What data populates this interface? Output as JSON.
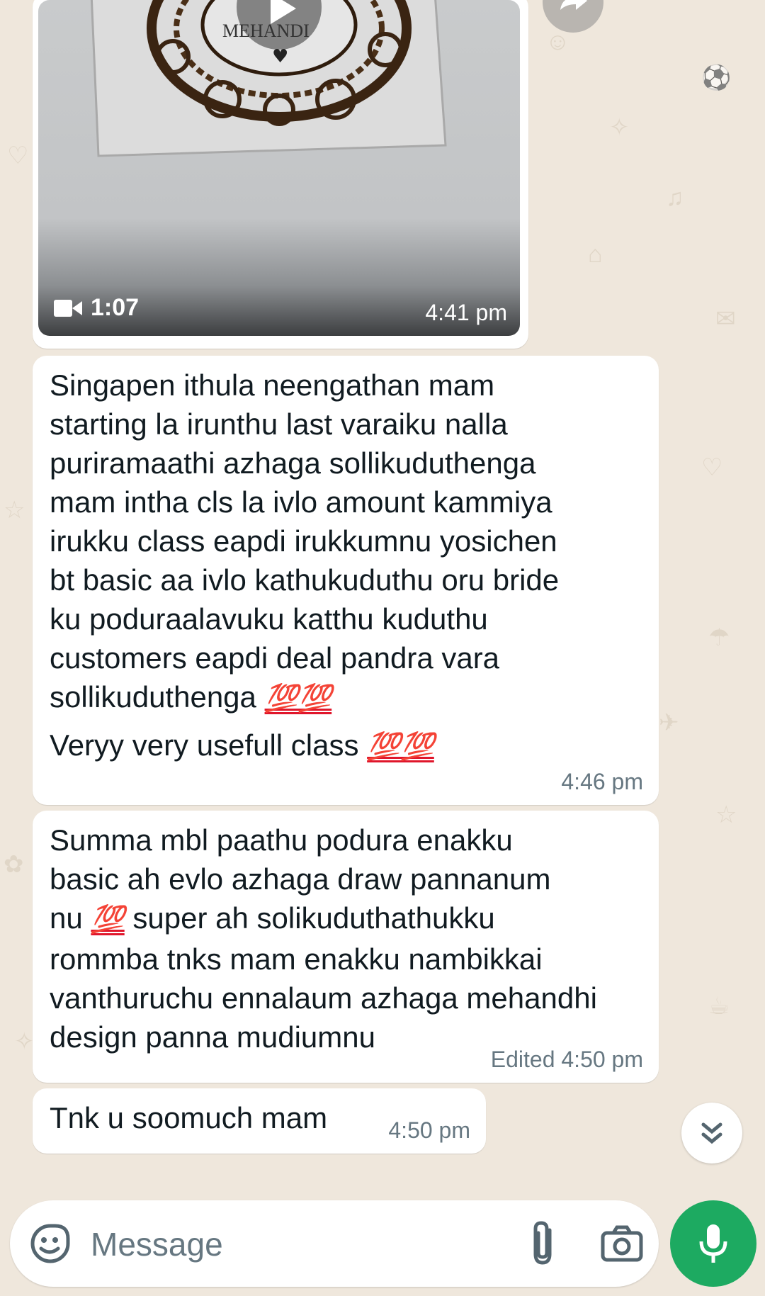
{
  "theme": {
    "bubble_bg": "#ffffff",
    "chat_bg": "#efe7dc",
    "timestamp_color": "#667781",
    "mic_color": "#1daa61"
  },
  "video_message": {
    "duration": "1:07",
    "time": "4:41 pm",
    "thumbnail_text": "MEHANDI",
    "icons": [
      "play-icon",
      "video-camera-icon",
      "forward-icon"
    ]
  },
  "messages": [
    {
      "text_main": "Singapen ithula neengathan mam\nstarting la irunthu last varaiku nalla\npuriramaathi azhaga sollikuduthenga\nmam intha cls la ivlo amount kammiya\nirukku class eapdi irukkumnu yosichen\nbt basic aa ivlo kathukuduthu oru bride\nku poduraalavuku katthu kuduthu\ncustomers eapdi deal pandra vara\nsollikuduthenga",
      "emoji_1": "💯💯",
      "text_2": "Veryy very usefull class",
      "emoji_2": "💯💯",
      "time": "4:46 pm"
    },
    {
      "text_a": "Summa mbl paathu podura enakku\nbasic ah evlo azhaga draw pannanum\nnu",
      "emoji": "💯",
      "text_b": "super ah solikuduthathukku\nrommba tnks mam enakku nambikkai\nvanthuruchu ennalaum azhaga mehandhi\ndesign panna mudiumnu",
      "meta": "Edited 4:50 pm"
    },
    {
      "text": "Tnk u soomuch mam",
      "time": "4:50 pm"
    }
  ],
  "composer": {
    "placeholder": "Message",
    "icons": [
      "emoji-sticker-icon",
      "attach-icon",
      "camera-icon",
      "mic-icon",
      "scroll-down-icon"
    ]
  }
}
